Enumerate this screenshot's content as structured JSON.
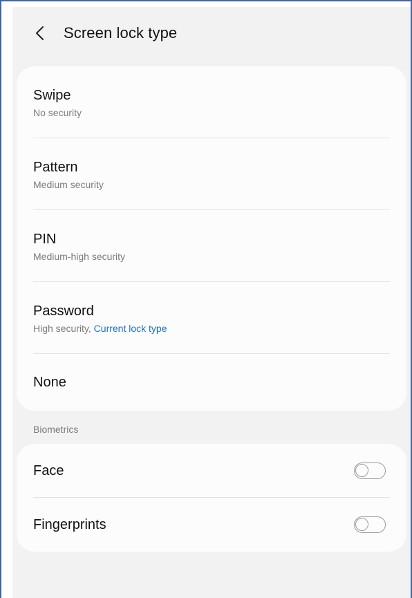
{
  "header": {
    "title": "Screen lock type",
    "back_icon": "chevron-left-icon"
  },
  "lock_types": [
    {
      "label": "Swipe",
      "subtitle": "No security"
    },
    {
      "label": "Pattern",
      "subtitle": "Medium security"
    },
    {
      "label": "PIN",
      "subtitle": "Medium-high security"
    },
    {
      "label": "Password",
      "subtitle": "High security, ",
      "current": "Current lock type"
    },
    {
      "label": "None"
    }
  ],
  "biometrics": {
    "section_label": "Biometrics",
    "items": [
      {
        "label": "Face",
        "enabled": false
      },
      {
        "label": "Fingerprints",
        "enabled": false
      }
    ]
  },
  "colors": {
    "accent": "#1e6fc1",
    "background": "#f2f2f2",
    "card": "#fcfcfc"
  }
}
